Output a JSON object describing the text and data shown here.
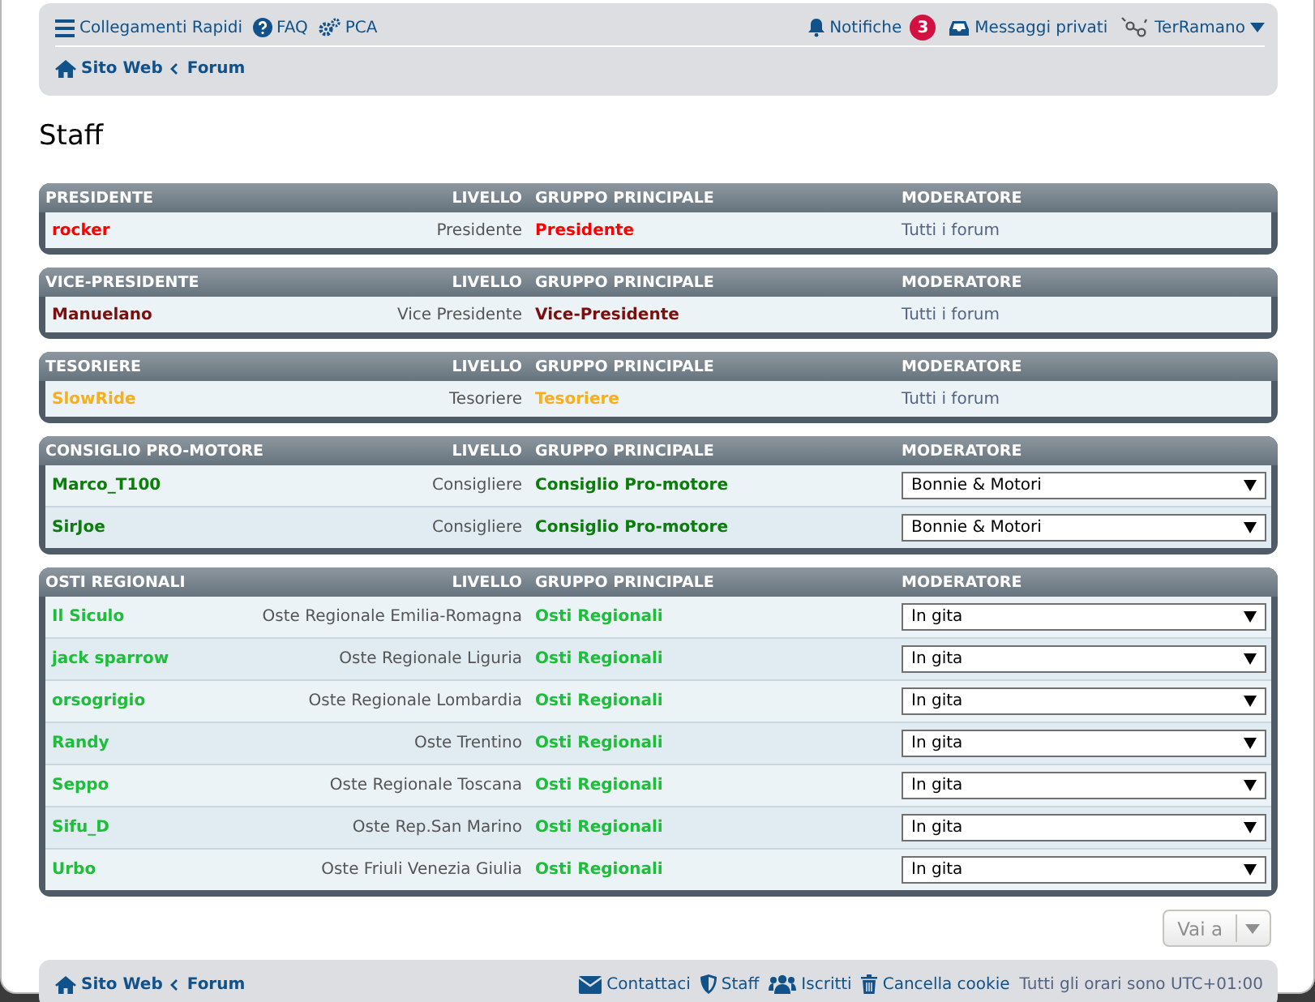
{
  "navbar": {
    "quick_links": "Collegamenti Rapidi",
    "faq": "FAQ",
    "acp": "PCA",
    "notifications": "Notifiche",
    "notification_count": "3",
    "private_messages": "Messaggi privati",
    "user": "TerRamano",
    "breadcrumbs": [
      "Sito Web",
      "Forum"
    ]
  },
  "title": "Staff",
  "groups": [
    {
      "name": "PRESIDENTE",
      "color": "#ff0000",
      "columns": [
        "LIVELLO",
        "GRUPPO PRINCIPALE",
        "MODERATORE"
      ],
      "members": [
        {
          "name": "rocker",
          "rank": "Presidente",
          "group": "Presidente",
          "moderator": {
            "kind": "text",
            "value": "Tutti i forum"
          }
        }
      ]
    },
    {
      "name": "VICE-PRESIDENTE",
      "color": "#7a0f0f",
      "columns": [
        "LIVELLO",
        "GRUPPO PRINCIPALE",
        "MODERATORE"
      ],
      "members": [
        {
          "name": "Manuelano",
          "rank": "Vice Presidente",
          "group": "Vice-Presidente",
          "moderator": {
            "kind": "text",
            "value": "Tutti i forum"
          }
        }
      ]
    },
    {
      "name": "TESORIERE",
      "color": "#f5b01a",
      "columns": [
        "LIVELLO",
        "GRUPPO PRINCIPALE",
        "MODERATORE"
      ],
      "members": [
        {
          "name": "SlowRide",
          "rank": "Tesoriere",
          "group": "Tesoriere",
          "moderator": {
            "kind": "text",
            "value": "Tutti i forum"
          }
        }
      ]
    },
    {
      "name": "CONSIGLIO PRO-MOTORE",
      "color": "#0a7d0a",
      "columns": [
        "LIVELLO",
        "GRUPPO PRINCIPALE",
        "MODERATORE"
      ],
      "members": [
        {
          "name": "Marco_T100",
          "rank": "Consigliere",
          "group": "Consiglio Pro-motore",
          "moderator": {
            "kind": "dropdown",
            "value": "Bonnie & Motori"
          }
        },
        {
          "name": "SirJoe",
          "rank": "Consigliere",
          "group": "Consiglio Pro-motore",
          "moderator": {
            "kind": "dropdown",
            "value": "Bonnie & Motori"
          }
        }
      ]
    },
    {
      "name": "OSTI REGIONALI",
      "color": "#1bbf3a",
      "columns": [
        "LIVELLO",
        "GRUPPO PRINCIPALE",
        "MODERATORE"
      ],
      "members": [
        {
          "name": "Il Siculo",
          "rank": "Oste Regionale Emilia-Romagna",
          "group": "Osti Regionali",
          "moderator": {
            "kind": "dropdown",
            "value": "In gita"
          }
        },
        {
          "name": "jack sparrow",
          "rank": "Oste Regionale Liguria",
          "group": "Osti Regionali",
          "moderator": {
            "kind": "dropdown",
            "value": "In gita"
          }
        },
        {
          "name": "orsogrigio",
          "rank": "Oste Regionale Lombardia",
          "group": "Osti Regionali",
          "moderator": {
            "kind": "dropdown",
            "value": "In gita"
          }
        },
        {
          "name": "Randy",
          "rank": "Oste Trentino",
          "group": "Osti Regionali",
          "moderator": {
            "kind": "dropdown",
            "value": "In gita"
          }
        },
        {
          "name": "Seppo",
          "rank": "Oste Regionale Toscana",
          "group": "Osti Regionali",
          "moderator": {
            "kind": "dropdown",
            "value": "In gita"
          }
        },
        {
          "name": "Sifu_D",
          "rank": "Oste Rep.San Marino",
          "group": "Osti Regionali",
          "moderator": {
            "kind": "dropdown",
            "value": "In gita"
          }
        },
        {
          "name": "Urbo",
          "rank": "Oste Friuli Venezia Giulia",
          "group": "Osti Regionali",
          "moderator": {
            "kind": "dropdown",
            "value": "In gita"
          }
        }
      ]
    }
  ],
  "jump_button": "Vai a",
  "footer": {
    "breadcrumbs": [
      "Sito Web",
      "Forum"
    ],
    "contact": "Contattaci",
    "staff": "Staff",
    "members": "Iscritti",
    "delete_cookies": "Cancella cookie",
    "timezone": "Tutti gli orari sono UTC+01:00"
  }
}
